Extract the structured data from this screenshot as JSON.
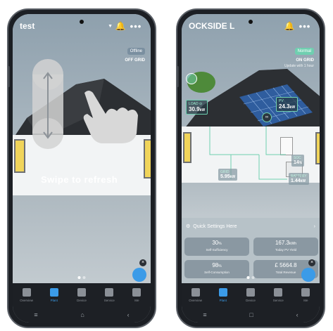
{
  "left": {
    "title": "test",
    "status_badge": "Offline",
    "grid_status": "OFF GRID",
    "swipe_text": "Swipe to refresh"
  },
  "right": {
    "title": "OCKSIDE L",
    "status_badge": "Normal",
    "grid_status": "ON GRID",
    "update_text": "Update  with 1 hour",
    "load": {
      "label": "LOAD",
      "value": "30.9",
      "unit": "kW"
    },
    "pv": {
      "label": "PV",
      "value": "24.3",
      "unit": "kW"
    },
    "grid": {
      "label": "GRID",
      "value": "5.95",
      "unit": "kW"
    },
    "soc": {
      "label": "SOC",
      "value": "14",
      "unit": "%"
    },
    "battery": {
      "label": "BATTERY",
      "value": "1.44",
      "unit": "kW"
    },
    "quick_settings": "Quick Settings Here",
    "cards": [
      {
        "value": "30",
        "unit": "%",
        "label": "Self-Sufficiency"
      },
      {
        "value": "167.3",
        "unit": "kWh",
        "label": "Today PV Yield"
      },
      {
        "value": "98",
        "unit": "%",
        "label": "Self-Consumption"
      },
      {
        "value": "£ 5664.8",
        "unit": "",
        "label": "Total Revenue"
      }
    ]
  },
  "nav": [
    "Overview",
    "Plant",
    "Device",
    "Service",
    "Me"
  ],
  "colors": {
    "accent": "#3b9be8",
    "normal": "#6fcfb0",
    "offline": "#7a8fa0"
  }
}
